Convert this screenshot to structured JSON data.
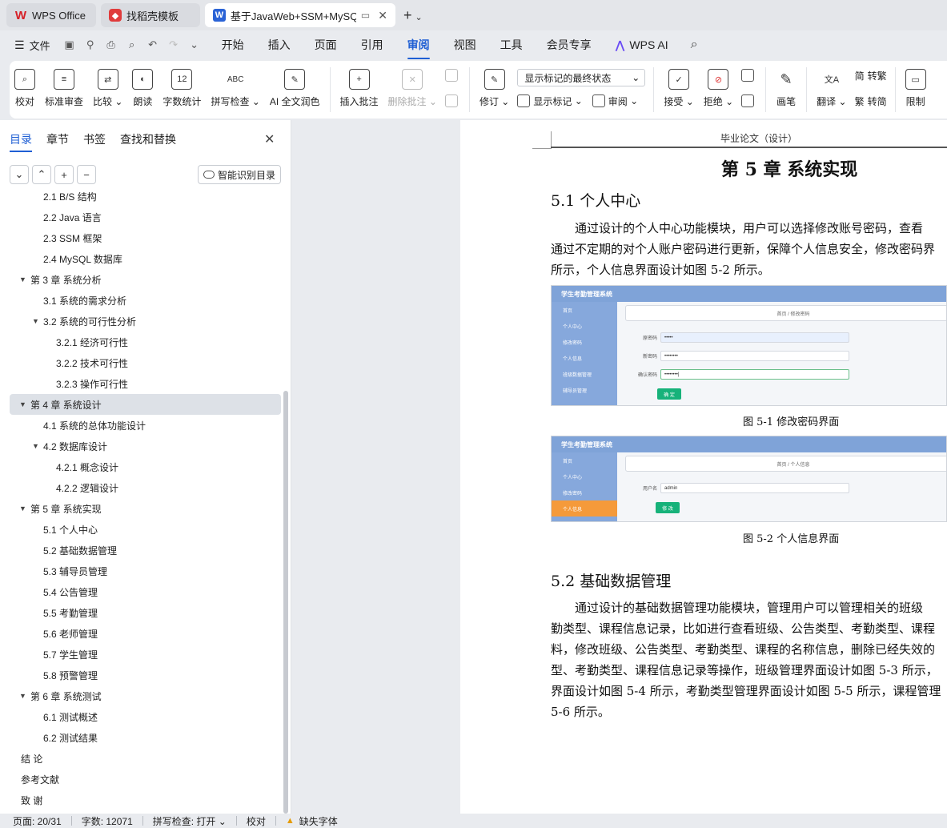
{
  "tabs": [
    {
      "label": "WPS Office",
      "icon": "wps-logo-icon"
    },
    {
      "label": "找稻壳模板",
      "icon": "docer-logo-icon"
    },
    {
      "label": "基于JavaWeb+SSM+MySQL",
      "icon": "word-doc-icon"
    }
  ],
  "menubar": {
    "file": "文件",
    "items": [
      "开始",
      "插入",
      "页面",
      "引用",
      "审阅",
      "视图",
      "工具",
      "会员专享"
    ],
    "active": "审阅",
    "ai": "WPS AI"
  },
  "ribbon": {
    "proofread": "校对",
    "std_review": "标准审查",
    "compare": "比较",
    "read_aloud": "朗读",
    "word_count": "字数统计",
    "spell_check": "拼写检查",
    "ai_polish": "AI 全文润色",
    "insert_comment": "插入批注",
    "delete_comment": "删除批注",
    "track": "修订",
    "display_select": "显示标记的最终状态",
    "show_markup": "显示标记",
    "review": "审阅",
    "accept": "接受",
    "reject": "拒绝",
    "pen": "画笔",
    "translate": "翻译",
    "to_trad": "转繁",
    "to_simp": "转简",
    "restrict": "限制"
  },
  "sidebar": {
    "tabs": [
      "目录",
      "章节",
      "书签",
      "查找和替换"
    ],
    "smart_toc": "智能识别目录",
    "toc": [
      {
        "label": "2.1 B/S 结构",
        "level": 2
      },
      {
        "label": "2.2 Java 语言",
        "level": 2
      },
      {
        "label": "2.3 SSM 框架",
        "level": 2
      },
      {
        "label": "2.4 MySQL 数据库",
        "level": 2
      },
      {
        "label": "第 3 章  系统分析",
        "level": 1,
        "caret": true
      },
      {
        "label": "3.1 系统的需求分析",
        "level": 2
      },
      {
        "label": "3.2 系统的可行性分析",
        "level": 2,
        "caret": true
      },
      {
        "label": "3.2.1 经济可行性",
        "level": 3
      },
      {
        "label": "3.2.2 技术可行性",
        "level": 3
      },
      {
        "label": "3.2.3 操作可行性",
        "level": 3
      },
      {
        "label": "第 4 章  系统设计",
        "level": 1,
        "caret": true,
        "selected": true
      },
      {
        "label": "4.1 系统的总体功能设计",
        "level": 2
      },
      {
        "label": "4.2 数据库设计",
        "level": 2,
        "caret": true
      },
      {
        "label": "4.2.1 概念设计",
        "level": 3
      },
      {
        "label": "4.2.2 逻辑设计",
        "level": 3
      },
      {
        "label": "第 5 章  系统实现",
        "level": 1,
        "caret": true
      },
      {
        "label": "5.1 个人中心",
        "level": 2
      },
      {
        "label": "5.2 基础数据管理",
        "level": 2
      },
      {
        "label": "5.3 辅导员管理",
        "level": 2
      },
      {
        "label": "5.4 公告管理",
        "level": 2
      },
      {
        "label": "5.5 考勤管理",
        "level": 2
      },
      {
        "label": "5.6 老师管理",
        "level": 2
      },
      {
        "label": "5.7 学生管理",
        "level": 2
      },
      {
        "label": "5.8 预警管理",
        "level": 2
      },
      {
        "label": "第 6 章    系统测试",
        "level": 1,
        "caret": true
      },
      {
        "label": "6.1    测试概述",
        "level": 2
      },
      {
        "label": "6.2    测试结果",
        "level": 2
      },
      {
        "label": "结      论",
        "level": 1
      },
      {
        "label": "参考文献",
        "level": 1
      },
      {
        "label": "致      谢",
        "level": 1
      }
    ]
  },
  "document": {
    "header": "毕业论文（设计）",
    "chapter": "第 5 章  系统实现",
    "s51": "5.1 个人中心",
    "p51": [
      "通过设计的个人中心功能模块，用户可以选择修改账号密码，查看",
      "通过不定期的对个人账户密码进行更新，保障个人信息安全，修改密码界",
      "所示，个人信息界面设计如图 5-2 所示。"
    ],
    "fig1": {
      "app": "学生考勤管理系统",
      "menu": [
        "首页",
        "个人中心",
        "修改密码",
        "个人信息",
        "班级数据管理",
        "辅导员管理"
      ],
      "crumb": "首页 / 修改密码",
      "fields": [
        {
          "label": "原密码",
          "value": "•••••"
        },
        {
          "label": "新密码",
          "value": "••••••••"
        },
        {
          "label": "确认密码",
          "value": "••••••••|"
        }
      ],
      "button": "确 定",
      "caption": "图 5-1 修改密码界面"
    },
    "fig2": {
      "app": "学生考勤管理系统",
      "menu": [
        "首页",
        "个人中心",
        "修改密码",
        "个人信息"
      ],
      "crumb": "首页 / 个人信息",
      "field_label": "用户名",
      "field_value": "admin",
      "button": "修 改",
      "caption": "图 5-2 个人信息界面"
    },
    "s52": "5.2 基础数据管理",
    "p52": [
      "通过设计的基础数据管理功能模块，管理用户可以管理相关的班级",
      "勤类型、课程信息记录，比如进行查看班级、公告类型、考勤类型、课程",
      "料，修改班级、公告类型、考勤类型、课程的名称信息，删除已经失效的",
      "型、考勤类型、课程信息记录等操作，班级管理界面设计如图 5-3 所示，",
      "界面设计如图 5-4 所示，考勤类型管理界面设计如图 5-5 所示，课程管理",
      "5-6 所示。"
    ]
  },
  "status": {
    "page": "页面: 20/31",
    "words": "字数: 12071",
    "spell": "拼写检查: 打开",
    "proof": "校对",
    "missing_font": "缺失字体"
  },
  "colors": {
    "accent": "#1f5fd4",
    "ok_green": "#17b27a",
    "side_blue": "#86a8dc",
    "menu_orange": "#f59a3a"
  }
}
